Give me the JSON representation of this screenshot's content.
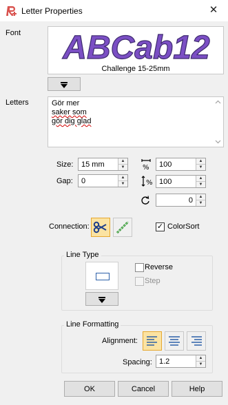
{
  "window": {
    "title": "Letter Properties",
    "close_glyph": "✕",
    "icon": "app-icon"
  },
  "font": {
    "label": "Font",
    "preview_sample": "ABCab12",
    "preview_name": "Challenge 15-25mm",
    "preview_color": "#7b4fc4",
    "dropdown_icon": "dropdown-arrow-icon"
  },
  "letters": {
    "label": "Letters",
    "lines": [
      "Gör mer",
      "saker som",
      "gör dig glad"
    ]
  },
  "size": {
    "label": "Size:",
    "value": "15 mm"
  },
  "gap": {
    "label": "Gap:",
    "value": "0"
  },
  "width_pct": {
    "icon": "width-percent-icon",
    "value": "100"
  },
  "height_pct": {
    "icon": "height-percent-icon",
    "value": "100"
  },
  "rotation": {
    "icon": "rotate-icon",
    "value": "0"
  },
  "connection": {
    "label": "Connection:",
    "scissors_icon": "scissors-icon",
    "stitch_icon": "running-stitch-icon"
  },
  "colorsort": {
    "label": "ColorSort",
    "checked": true,
    "check_glyph": "✓"
  },
  "line_type": {
    "title": "Line Type",
    "reverse_label": "Reverse",
    "step_label": "Step"
  },
  "line_formatting": {
    "title": "Line Formatting",
    "alignment_label": "Alignment:",
    "spacing_label": "Spacing:",
    "spacing_value": "1.2",
    "align_selected": "left"
  },
  "buttons": {
    "ok": "OK",
    "cancel": "Cancel",
    "help": "Help"
  },
  "colors": {
    "selected_fill": "#fbe3a2",
    "selected_border": "#e6a72e",
    "align_icon": "#2b5fa8"
  }
}
